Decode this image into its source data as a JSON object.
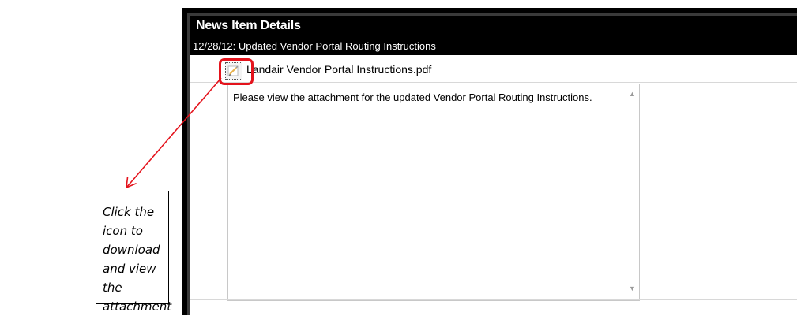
{
  "header": {
    "title": "News Item Details",
    "subtitle": "12/28/12: Updated Vendor Portal Routing Instructions"
  },
  "attachment": {
    "icon": "pdf-attachment-icon",
    "filename": "Landair Vendor Portal Instructions.pdf"
  },
  "content": {
    "body": "Please view the attachment for the updated Vendor Portal Routing Instructions."
  },
  "annotation": {
    "callout": "Click the icon to download and view the attachment",
    "highlight_color": "#e4131c"
  }
}
